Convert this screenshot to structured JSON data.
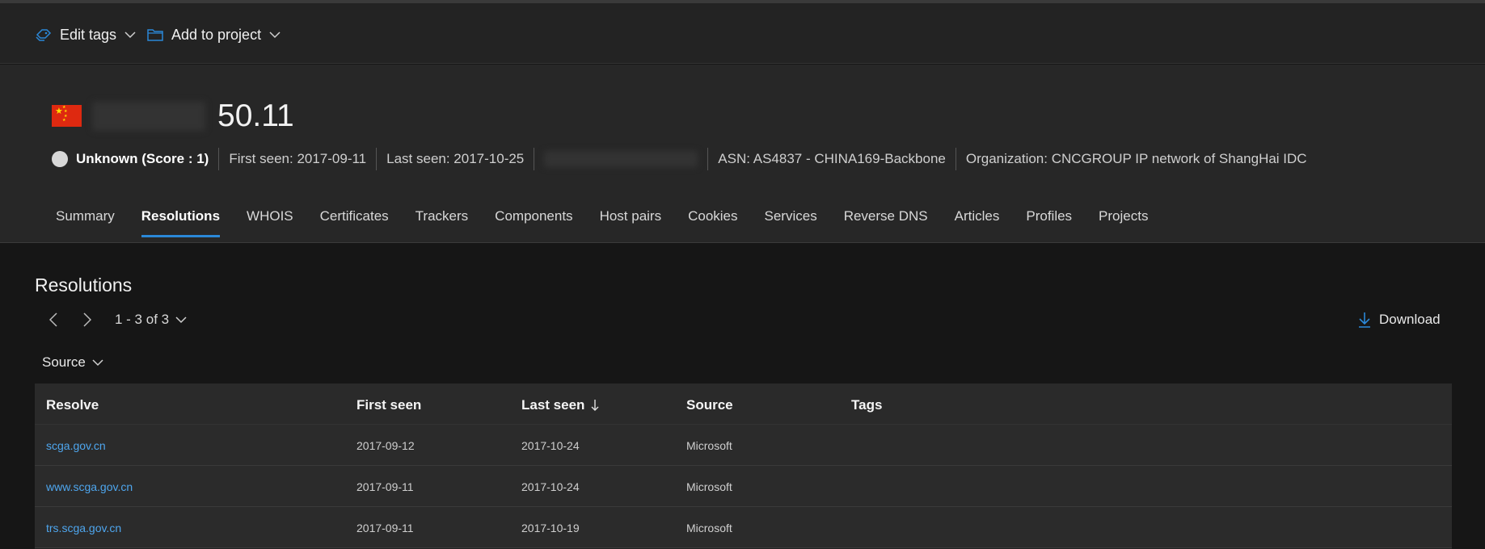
{
  "toolbar": {
    "edit_tags": "Edit tags",
    "add_to_project": "Add to project"
  },
  "header": {
    "ip": "50.11",
    "reputation": "Unknown (Score : 1)",
    "first_seen": "First seen: 2017-09-11",
    "last_seen": "Last seen: 2017-10-25",
    "asn": "ASN: AS4837 - CHINA169-Backbone",
    "organization": "Organization: CNCGROUP IP network of ShangHai IDC"
  },
  "tabs": [
    "Summary",
    "Resolutions",
    "WHOIS",
    "Certificates",
    "Trackers",
    "Components",
    "Host pairs",
    "Cookies",
    "Services",
    "Reverse DNS",
    "Articles",
    "Profiles",
    "Projects"
  ],
  "active_tab": "Resolutions",
  "section": {
    "title": "Resolutions",
    "range": "1 - 3 of 3",
    "download": "Download",
    "filter": "Source"
  },
  "table": {
    "headers": [
      "Resolve",
      "First seen",
      "Last seen",
      "Source",
      "Tags"
    ],
    "rows": [
      [
        "scga.gov.cn",
        "2017-09-12",
        "2017-10-24",
        "Microsoft",
        ""
      ],
      [
        "www.scga.gov.cn",
        "2017-09-11",
        "2017-10-24",
        "Microsoft",
        ""
      ],
      [
        "trs.scga.gov.cn",
        "2017-09-11",
        "2017-10-19",
        "Microsoft",
        ""
      ]
    ]
  },
  "colors": {
    "accent": "#2b88d8",
    "link": "#4ea6ee",
    "flag": "#de2910"
  }
}
